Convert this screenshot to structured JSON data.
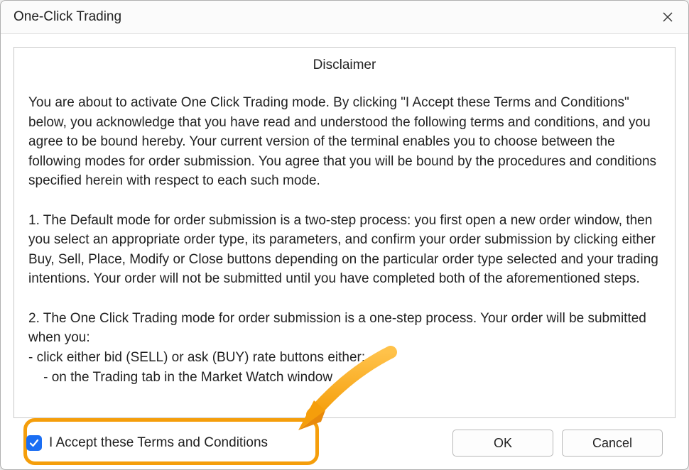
{
  "dialog": {
    "title": "One-Click Trading"
  },
  "disclaimer": {
    "heading": "Disclaimer",
    "paragraph1": "You are about to activate One Click Trading mode. By clicking \"I Accept these Terms and Conditions\" below, you acknowledge that you have read and understood the following terms and conditions, and you agree to be bound hereby. Your current version of the terminal enables you to choose between the following modes for order submission. You agree that you will be bound by the procedures and conditions specified herein with respect to each such mode.",
    "paragraph2": "1. The Default mode for order submission is a two-step process: you first open a new order window, then you select an appropriate order type, its parameters, and confirm your order submission by clicking either Buy, Sell, Place, Modify or Close buttons depending on the particular order type selected and your trading intentions. Your order will not be submitted until you have completed both of the aforementioned steps.",
    "paragraph3": "2. The One Click Trading mode for order submission is a one-step process. Your order will be submitted when you:",
    "paragraph4_line1": "- click either bid (SELL) or ask (BUY) rate buttons either:",
    "paragraph4_line2": "    - on the Trading tab in the Market Watch window"
  },
  "checkbox": {
    "label": "I Accept these Terms and Conditions",
    "checked": true
  },
  "buttons": {
    "ok": "OK",
    "cancel": "Cancel"
  }
}
